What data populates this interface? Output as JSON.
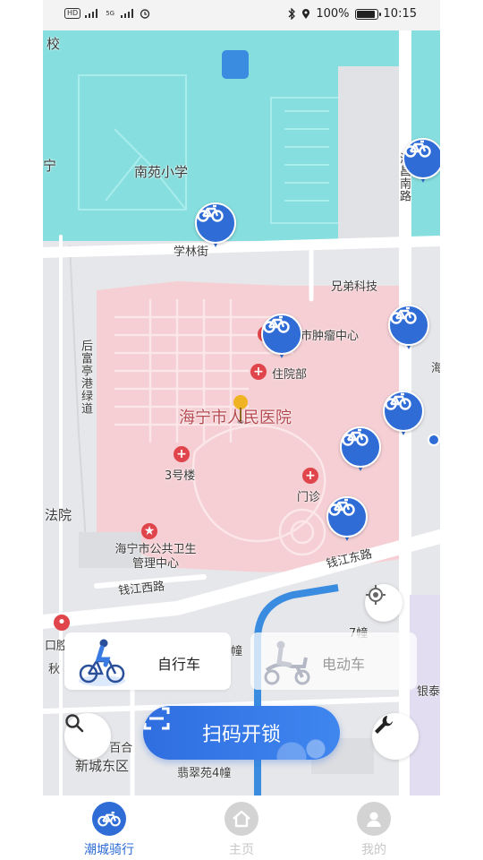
{
  "status_bar": {
    "left_indicators": [
      "HD",
      "4G",
      "5G"
    ],
    "battery_text": "100%",
    "battery_level": 1.0,
    "time": "10:15"
  },
  "map": {
    "labels": {
      "school_top": "校",
      "nanyuan_school": "南苑小学",
      "xuelin_street": "学林街",
      "xiongdi_tech": "兄弟科技",
      "tumor_center": "市肿瘤中心",
      "inpatient": "住院部",
      "houfu_greenway": "后富亭港绿道",
      "hospital": "海宁市人民医院",
      "building3": "3号楼",
      "outpatient": "门诊",
      "court": "法院",
      "health_center": "海宁市公共卫生管理中心",
      "qianjiang_east": "钱江东路",
      "qianjiang_west": "钱江西路",
      "left_edge_ning": "宁",
      "right_road": "海昌南路",
      "right_edge_hai": "海",
      "right_edge_yin": "银泰",
      "block_7": "7幢",
      "block_u": "幢",
      "bottom_left_a": "口腔",
      "bottom_left_b": "秋",
      "baihe": "·百合",
      "xincheng_east": "新城东区",
      "feicui": "翡翠苑4幢"
    },
    "colors": {
      "base": "#e6e7ea",
      "school_area": "#86dede",
      "hospital_area": "#f5cfd3",
      "road": "#ffffff",
      "water": "#3a8ce0",
      "pin": "#2f6cd6",
      "poi_red": "#e0454b",
      "mall_area": "#e2ddf0"
    }
  },
  "vehicle_types": {
    "bike_label": "自行车",
    "ebike_label": "电动车",
    "selected": "自行车"
  },
  "actions": {
    "scan_label": "扫码开锁",
    "search_icon": "search-icon",
    "repair_icon": "wrench-icon",
    "locate_icon": "locate-icon"
  },
  "tabbar": {
    "tabs": [
      {
        "label": "潮城骑行",
        "icon": "bike-icon",
        "active": true
      },
      {
        "label": "主页",
        "icon": "home-icon",
        "active": false
      },
      {
        "label": "我的",
        "icon": "user-icon",
        "active": false
      }
    ]
  }
}
